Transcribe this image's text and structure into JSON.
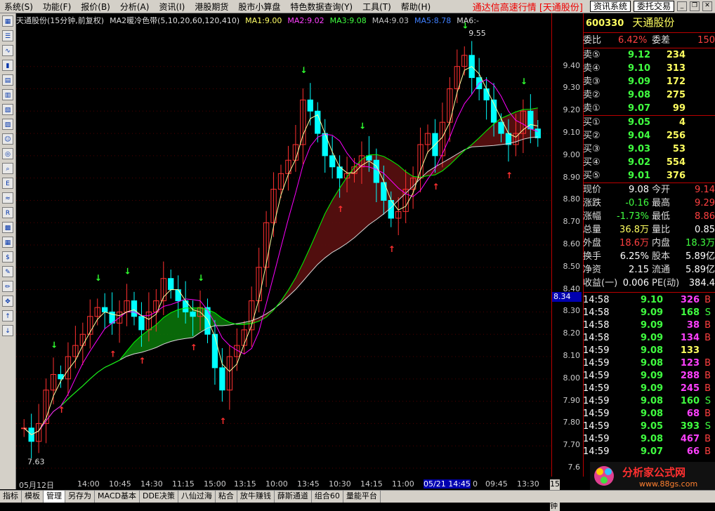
{
  "menu": [
    "系统(S)",
    "功能(F)",
    "报价(B)",
    "分析(A)",
    "资讯(I)",
    "港股期货",
    "股市小算盘",
    "特色数据查询(Y)",
    "工具(T)",
    "帮助(H)"
  ],
  "brand": "通达信高速行情 [天通股份]",
  "buttons": {
    "info": "资讯系统",
    "trade": "委托交易"
  },
  "chart_info": {
    "title": "天通股份(15分钟,前复权)",
    "indicator": "MA2暖冷色带(5,10,20,60,120,410)",
    "ma1": "MA1:9.00",
    "ma2": "MA2:9.02",
    "ma3": "MA3:9.08",
    "ma4": "MA4:9.03",
    "ma5": "MA5:8.78",
    "ma6": "MA6:-"
  },
  "colors": {
    "up": "#ff3030",
    "down": "#00ffff",
    "ma1": "#ffffff",
    "ma2": "#ff00ff",
    "ma3": "#00ff00",
    "ma4": "#c0c0c0",
    "ma5": "#3060ff",
    "green_band": "#0a7a0a",
    "red_band": "#5a1010",
    "accent": "#ff4040"
  },
  "price_labels": {
    "high": "9.55",
    "low": "7.63",
    "current": "8.34"
  },
  "price_axis": [
    "9.40",
    "9.30",
    "9.20",
    "9.10",
    "9.00",
    "8.90",
    "8.80",
    "8.70",
    "8.60",
    "8.50",
    "8.40",
    "8.30",
    "8.20",
    "8.10",
    "8.00",
    "7.90",
    "7.80",
    "7.70",
    "7.6"
  ],
  "time_axis": [
    "05月12日",
    "14:00",
    "10:45",
    "14:30",
    "11:15",
    "15:00",
    "13:15",
    "10:00",
    "13:45",
    "10:30",
    "14:15",
    "11:00",
    "05/21 14:45",
    "0",
    "09:45",
    "13:30",
    "15分钟"
  ],
  "stock": {
    "code": "600330",
    "name": "天通股份"
  },
  "quote": {
    "weibi_label": "委比",
    "weibi": "6.42%",
    "weicha_label": "委差",
    "weicha": "150"
  },
  "asks": [
    {
      "label": "卖⑤",
      "price": "9.12",
      "vol": "234"
    },
    {
      "label": "卖④",
      "price": "9.10",
      "vol": "313"
    },
    {
      "label": "卖③",
      "price": "9.09",
      "vol": "172"
    },
    {
      "label": "卖②",
      "price": "9.08",
      "vol": "275"
    },
    {
      "label": "卖①",
      "price": "9.07",
      "vol": "99"
    }
  ],
  "bids": [
    {
      "label": "买①",
      "price": "9.05",
      "vol": "4"
    },
    {
      "label": "买②",
      "price": "9.04",
      "vol": "256"
    },
    {
      "label": "买③",
      "price": "9.03",
      "vol": "53"
    },
    {
      "label": "买④",
      "price": "9.02",
      "vol": "554"
    },
    {
      "label": "买⑤",
      "price": "9.01",
      "vol": "376"
    }
  ],
  "stats": [
    {
      "l1": "现价",
      "v1": "9.08",
      "l2": "今开",
      "v2": "9.14"
    },
    {
      "l1": "涨跌",
      "v1": "-0.16",
      "l2": "最高",
      "v2": "9.29"
    },
    {
      "l1": "涨幅",
      "v1": "-1.73%",
      "l2": "最低",
      "v2": "8.86"
    },
    {
      "l1": "总量",
      "v1": "36.8万",
      "l2": "量比",
      "v2": "0.85"
    },
    {
      "l1": "外盘",
      "v1": "18.6万",
      "l2": "内盘",
      "v2": "18.3万"
    },
    {
      "l1": "换手",
      "v1": "6.25%",
      "l2": "股本",
      "v2": "5.89亿"
    },
    {
      "l1": "净资",
      "v1": "2.15",
      "l2": "流通",
      "v2": "5.89亿"
    },
    {
      "l1": "收益(一)",
      "v1": "0.006",
      "l2": "PE(动)",
      "v2": "384.4"
    }
  ],
  "ticks": [
    {
      "t": "14:58",
      "p": "9.10",
      "v": "326",
      "d": "B"
    },
    {
      "t": "14:58",
      "p": "9.09",
      "v": "168",
      "d": "S"
    },
    {
      "t": "14:58",
      "p": "9.09",
      "v": "38",
      "d": "B"
    },
    {
      "t": "14:58",
      "p": "9.09",
      "v": "134",
      "d": "B"
    },
    {
      "t": "14:59",
      "p": "9.08",
      "v": "133",
      "d": ""
    },
    {
      "t": "14:59",
      "p": "9.08",
      "v": "123",
      "d": "B"
    },
    {
      "t": "14:59",
      "p": "9.09",
      "v": "288",
      "d": "B"
    },
    {
      "t": "14:59",
      "p": "9.09",
      "v": "245",
      "d": "B"
    },
    {
      "t": "14:59",
      "p": "9.08",
      "v": "160",
      "d": "S"
    },
    {
      "t": "14:59",
      "p": "9.08",
      "v": "68",
      "d": "B"
    },
    {
      "t": "14:59",
      "p": "9.05",
      "v": "393",
      "d": "S"
    },
    {
      "t": "14:59",
      "p": "9.08",
      "v": "467",
      "d": "B"
    },
    {
      "t": "14:59",
      "p": "9.07",
      "v": "66",
      "d": "B"
    }
  ],
  "tabs": [
    "指标",
    "模板",
    "管理",
    "另存为",
    "MACD基本",
    "DDE决策",
    "八仙过海",
    "粘合",
    "放牛赚钱",
    "薛斯通道",
    "组合60",
    "量能平台"
  ],
  "watermark": {
    "text": "分析家公式网",
    "url": "www.88gs.com"
  },
  "chart_data": {
    "type": "candlestick",
    "title": "天通股份(15分钟,前复权)",
    "ylim": [
      7.6,
      9.55
    ],
    "close": [
      7.78,
      7.72,
      7.8,
      7.95,
      8.02,
      8.0,
      8.1,
      8.15,
      8.2,
      8.28,
      8.32,
      8.3,
      8.25,
      8.3,
      8.35,
      8.28,
      8.22,
      8.3,
      8.35,
      8.45,
      8.4,
      8.35,
      8.3,
      8.28,
      8.32,
      8.2,
      8.05,
      7.95,
      8.1,
      8.15,
      8.22,
      8.35,
      8.5,
      8.7,
      8.85,
      8.92,
      8.98,
      9.05,
      9.25,
      9.2,
      9.1,
      9.0,
      8.95,
      8.9,
      8.92,
      8.95,
      9.0,
      8.98,
      8.88,
      8.8,
      8.72,
      8.75,
      8.85,
      8.9,
      9.05,
      9.1,
      9.0,
      9.15,
      9.3,
      9.4,
      9.45,
      9.35,
      9.3,
      9.25,
      9.15,
      9.1,
      9.05,
      9.1,
      9.2,
      9.12,
      9.08
    ]
  }
}
